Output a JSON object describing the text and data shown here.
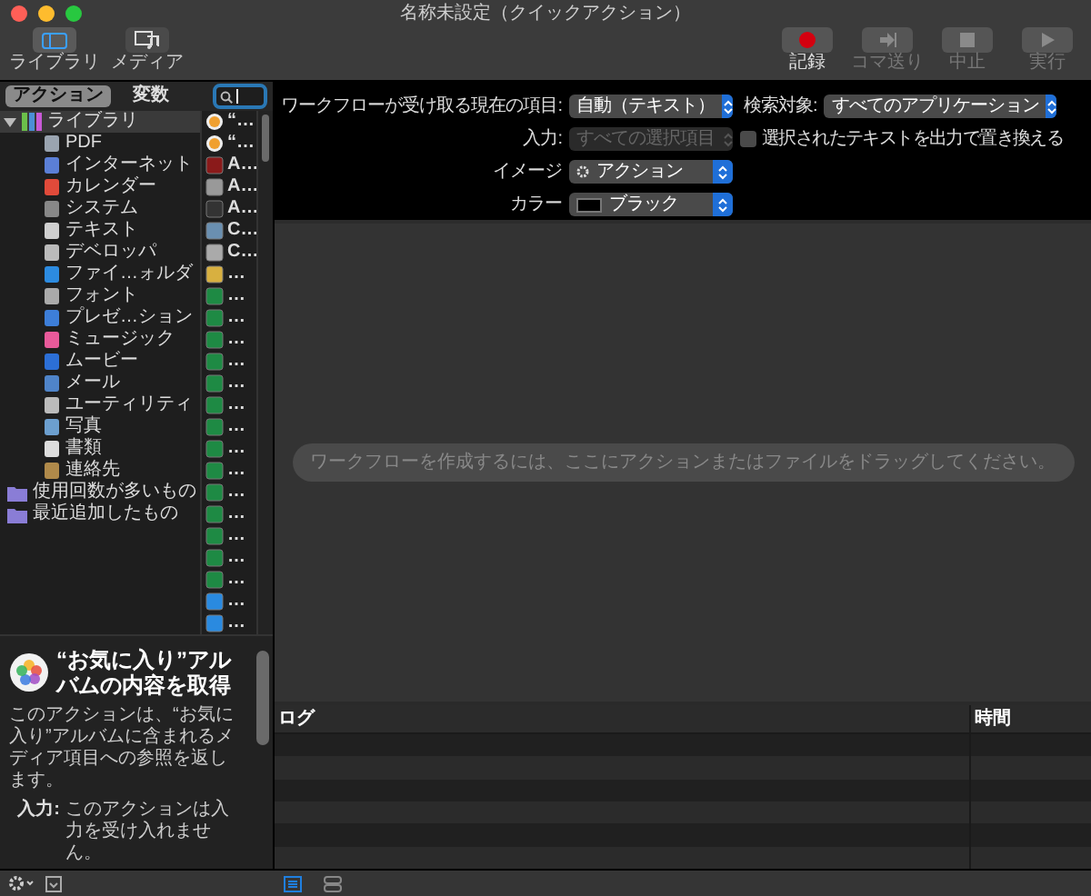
{
  "window": {
    "title": "名称未設定（クイックアクション）"
  },
  "toolbar": {
    "left": [
      {
        "label": "ライブラリ",
        "selected": true
      },
      {
        "label": "メディア",
        "selected": false
      }
    ],
    "right": [
      {
        "label": "記録",
        "disabled": false
      },
      {
        "label": "コマ送り",
        "disabled": true
      },
      {
        "label": "中止",
        "disabled": true
      },
      {
        "label": "実行",
        "disabled": true
      }
    ]
  },
  "library_tabs": [
    {
      "label": "アクション",
      "selected": true
    },
    {
      "label": "変数",
      "selected": false
    }
  ],
  "categories": [
    {
      "label": "ライブラリ",
      "expanded": true,
      "children": [
        {
          "label": "PDF"
        },
        {
          "label": "インターネット"
        },
        {
          "label": "カレンダー"
        },
        {
          "label": "システム"
        },
        {
          "label": "テキスト"
        },
        {
          "label": "デベロッパ"
        },
        {
          "label": "ファイ…ォルダ"
        },
        {
          "label": "フォント"
        },
        {
          "label": "プレゼ…ション"
        },
        {
          "label": "ミュージック"
        },
        {
          "label": "ムービー"
        },
        {
          "label": "メール"
        },
        {
          "label": "ユーティリティ"
        },
        {
          "label": "写真"
        },
        {
          "label": "書類"
        },
        {
          "label": "連絡先"
        }
      ]
    },
    {
      "label": "使用回数が多いもの"
    },
    {
      "label": "最近追加したもの"
    }
  ],
  "actions": [
    {
      "label": "“…"
    },
    {
      "label": "“…"
    },
    {
      "label": "A…"
    },
    {
      "label": "A…"
    },
    {
      "label": "A…"
    },
    {
      "label": "C…"
    },
    {
      "label": "C…"
    },
    {
      "label": "…"
    },
    {
      "label": "…"
    },
    {
      "label": "…"
    },
    {
      "label": "…"
    },
    {
      "label": "…"
    },
    {
      "label": "…"
    },
    {
      "label": "…"
    },
    {
      "label": "…"
    },
    {
      "label": "…"
    },
    {
      "label": "…"
    },
    {
      "label": "…"
    },
    {
      "label": "…"
    },
    {
      "label": "…"
    },
    {
      "label": "…"
    },
    {
      "label": "…"
    },
    {
      "label": "…"
    },
    {
      "label": "…"
    }
  ],
  "description": {
    "title": "“お気に入り”アルバムの内容を取得",
    "body": "このアクションは、“お気に入り”アルバムに含まれるメディア項目への参照を返します。",
    "input_label": "入力:",
    "input_text": "このアクションは入力を受け入れません。"
  },
  "settings": {
    "receives": {
      "label": "ワークフローが受け取る現在の項目:",
      "value": "自動（テキスト）",
      "disabled": false
    },
    "search_in": {
      "label": "検索対象:",
      "value": "すべてのアプリケーション",
      "disabled": false
    },
    "input": {
      "label": "入力:",
      "value": "すべての選択項目",
      "disabled": true
    },
    "replace": {
      "label": "選択されたテキストを出力で置き換える",
      "checked": false
    },
    "image": {
      "label": "イメージ",
      "value": "アクション",
      "disabled": false
    },
    "color": {
      "label": "カラー",
      "value": "ブラック",
      "color": "#000000",
      "disabled": false
    }
  },
  "drop_hint": "ワークフローを作成するには、ここにアクションまたはファイルをドラッグしてください。",
  "log": {
    "columns": [
      "ログ",
      "時間"
    ]
  },
  "view_buttons": [
    {
      "selected": true
    },
    {
      "selected": false
    }
  ]
}
